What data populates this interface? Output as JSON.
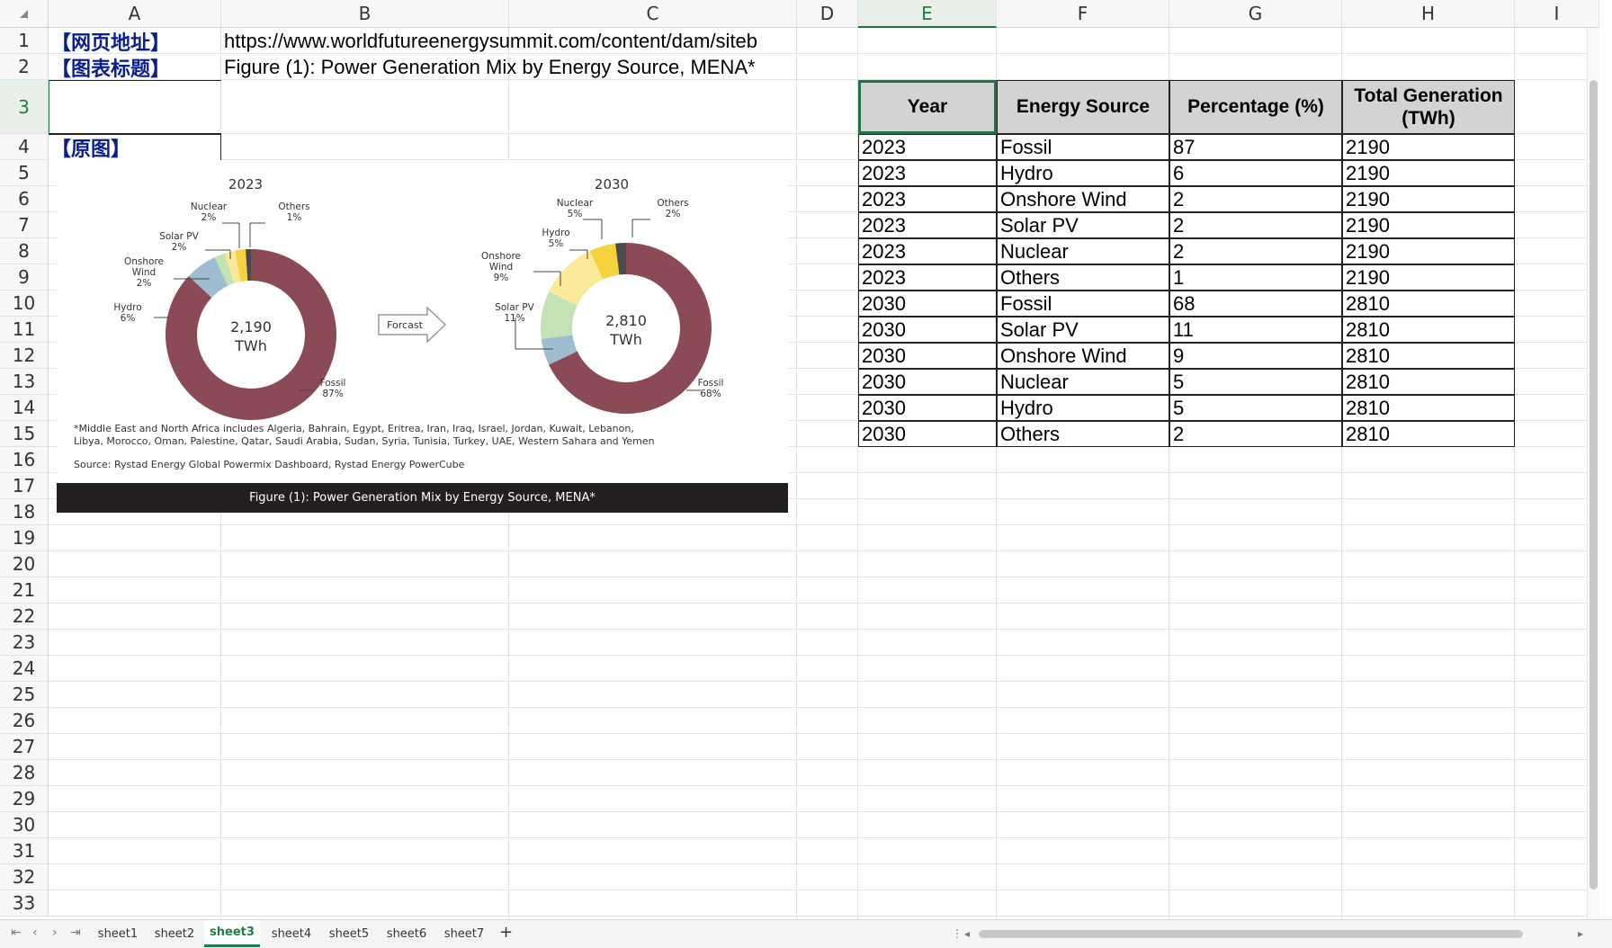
{
  "columns": [
    "A",
    "B",
    "C",
    "D",
    "E",
    "F",
    "G",
    "H",
    "I"
  ],
  "rows": [
    "1",
    "2",
    "3",
    "4",
    "5",
    "6",
    "7",
    "8",
    "9",
    "10",
    "11",
    "12",
    "13",
    "14",
    "15",
    "16",
    "17",
    "18",
    "19",
    "20",
    "21",
    "22",
    "23",
    "24",
    "25",
    "26",
    "27",
    "28",
    "29",
    "30",
    "31",
    "32",
    "33"
  ],
  "active_cell": {
    "column": "E",
    "row": "3"
  },
  "cells": {
    "A1": "【网页地址】",
    "B1": "https://www.worldfutureenergysummit.com/content/dam/siteb",
    "A2": "【图表标题】",
    "B2": "Figure (1): Power Generation Mix by Energy Source, MENA*",
    "A4": "【原图】"
  },
  "table": {
    "headers": [
      "Year",
      "Energy Source",
      "Percentage (%)",
      "Total Generation (TWh)"
    ],
    "rows": [
      [
        "2023",
        "Fossil",
        "87",
        "2190"
      ],
      [
        "2023",
        "Hydro",
        "6",
        "2190"
      ],
      [
        "2023",
        "Onshore Wind",
        "2",
        "2190"
      ],
      [
        "2023",
        "Solar PV",
        "2",
        "2190"
      ],
      [
        "2023",
        "Nuclear",
        "2",
        "2190"
      ],
      [
        "2023",
        "Others",
        "1",
        "2190"
      ],
      [
        "2030",
        "Fossil",
        "68",
        "2810"
      ],
      [
        "2030",
        "Solar PV",
        "11",
        "2810"
      ],
      [
        "2030",
        "Onshore Wind",
        "9",
        "2810"
      ],
      [
        "2030",
        "Nuclear",
        "5",
        "2810"
      ],
      [
        "2030",
        "Hydro",
        "5",
        "2810"
      ],
      [
        "2030",
        "Others",
        "2",
        "2810"
      ]
    ]
  },
  "figure": {
    "left_year": "2023",
    "right_year": "2030",
    "left_total": "2,190",
    "right_total": "2,810",
    "unit": "TWh",
    "arrow_label": "Forcast",
    "left_labels": {
      "nuclear": [
        "Nuclear",
        "2%"
      ],
      "others": [
        "Others",
        "1%"
      ],
      "solar": [
        "Solar PV",
        "2%"
      ],
      "wind": [
        "Onshore",
        "Wind",
        "2%"
      ],
      "hydro": [
        "Hydro",
        "6%"
      ],
      "fossil": [
        "Fossil",
        "87%"
      ]
    },
    "right_labels": {
      "nuclear": [
        "Nuclear",
        "5%"
      ],
      "others": [
        "Others",
        "2%"
      ],
      "hydro": [
        "Hydro",
        "5%"
      ],
      "wind": [
        "Onshore",
        "Wind",
        "9%"
      ],
      "solar": [
        "Solar PV",
        "11%"
      ],
      "fossil": [
        "Fossil",
        "68%"
      ]
    },
    "footnote_1": "*Middle East and North Africa includes Algeria, Bahrain, Egypt, Eritrea, Iran, Iraq, Israel, Jordan, Kuwait, Lebanon,",
    "footnote_2": "Libya, Morocco, Oman, Palestine, Qatar, Saudi Arabia, Sudan, Syria, Tunisia, Turkey, UAE, Western Sahara and Yemen",
    "source": "Source: Rystad Energy Global Powermix Dashboard, Rystad Energy PowerCube",
    "caption": "Figure (1): Power Generation Mix by Energy Source, MENA*"
  },
  "colors": {
    "fossil": "#8a4b57",
    "hydro": "#9fbdd0",
    "wind": "#c3e2b5",
    "solar": "#fbe99a",
    "nuclear": "#f6d23c",
    "others": "#4a4a4a",
    "accent": "#217346",
    "label_blue": "#0a1f8f"
  },
  "sheets": [
    "sheet1",
    "sheet2",
    "sheet3",
    "sheet4",
    "sheet5",
    "sheet6",
    "sheet7"
  ],
  "active_sheet": "sheet3",
  "add_sheet_glyph": "+"
}
